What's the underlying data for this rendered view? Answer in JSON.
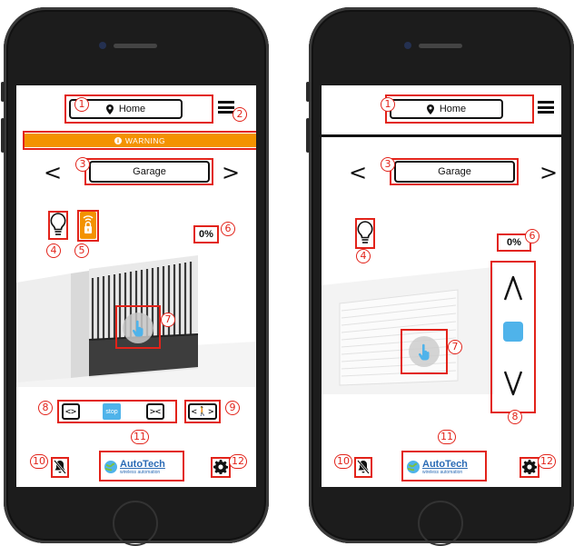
{
  "location": {
    "label": "Home"
  },
  "warning": {
    "label": "WARNING"
  },
  "device": {
    "label": "Garage",
    "prev": "<",
    "next": ">"
  },
  "left_phone": {
    "percent": "0%",
    "controls": {
      "open": "<>",
      "stop": "stop",
      "close": "><",
      "pedestrian": "<🚶>"
    }
  },
  "right_phone": {
    "percent": "0%",
    "controls": {
      "up": "/\\",
      "down": "\\/"
    }
  },
  "brand": {
    "name": "AutoTech",
    "tagline": "wireless automation"
  },
  "callouts": [
    "1",
    "2",
    "3",
    "4",
    "5",
    "6",
    "7",
    "8",
    "9",
    "10",
    "11",
    "12"
  ],
  "colors": {
    "warning": "#f39200",
    "accent": "#4fb3ea",
    "callout": "#e2231a"
  }
}
